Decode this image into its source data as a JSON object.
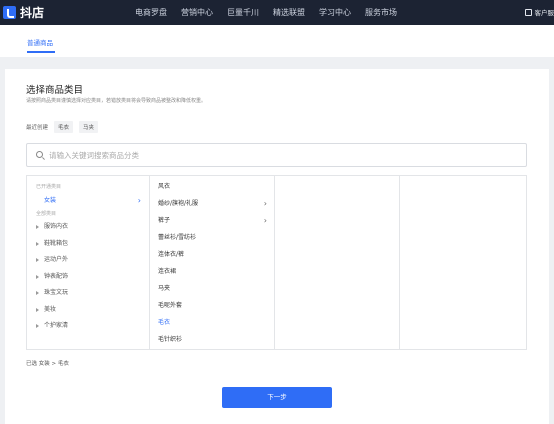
{
  "header": {
    "brand": "抖店",
    "nav": [
      "电商罗盘",
      "营销中心",
      "巨量千川",
      "精选联盟",
      "学习中心",
      "服务市场"
    ],
    "service": "客户服"
  },
  "tabs": {
    "active": "普通商品"
  },
  "page": {
    "title": "选择商品类目",
    "subtitle": "请按照商品类目谨慎选择对应类目，若错放类目将会导致商品被整改和降低权重。",
    "recent_label": "最近创建",
    "recent": [
      "毛衣",
      "马夹"
    ],
    "search_placeholder": "请输入关键词搜索商品分类"
  },
  "categories": {
    "opened_label": "已开通类目",
    "opened": [
      "女装"
    ],
    "all_label": "全部类目",
    "all": [
      "服饰内衣",
      "鞋靴箱包",
      "运动户外",
      "钟表配饰",
      "珠宝文玩",
      "美妆",
      "个护家清"
    ]
  },
  "subcategories": [
    {
      "label": "风衣",
      "has_children": false,
      "active": false
    },
    {
      "label": "婚纱/旗袍/礼服",
      "has_children": true,
      "active": false
    },
    {
      "label": "裤子",
      "has_children": true,
      "active": false
    },
    {
      "label": "蕾丝衫/雪纺衫",
      "has_children": false,
      "active": false
    },
    {
      "label": "连体衣/裤",
      "has_children": false,
      "active": false
    },
    {
      "label": "连衣裙",
      "has_children": false,
      "active": false
    },
    {
      "label": "马夹",
      "has_children": false,
      "active": false
    },
    {
      "label": "毛呢外套",
      "has_children": false,
      "active": false
    },
    {
      "label": "毛衣",
      "has_children": false,
      "active": true
    },
    {
      "label": "毛针织衫",
      "has_children": false,
      "active": false
    }
  ],
  "footer": {
    "selected": "已选 女装 > 毛衣",
    "next_label": "下一步"
  },
  "colors": {
    "accent": "#2f6df6",
    "topbar": "#1c2333"
  }
}
